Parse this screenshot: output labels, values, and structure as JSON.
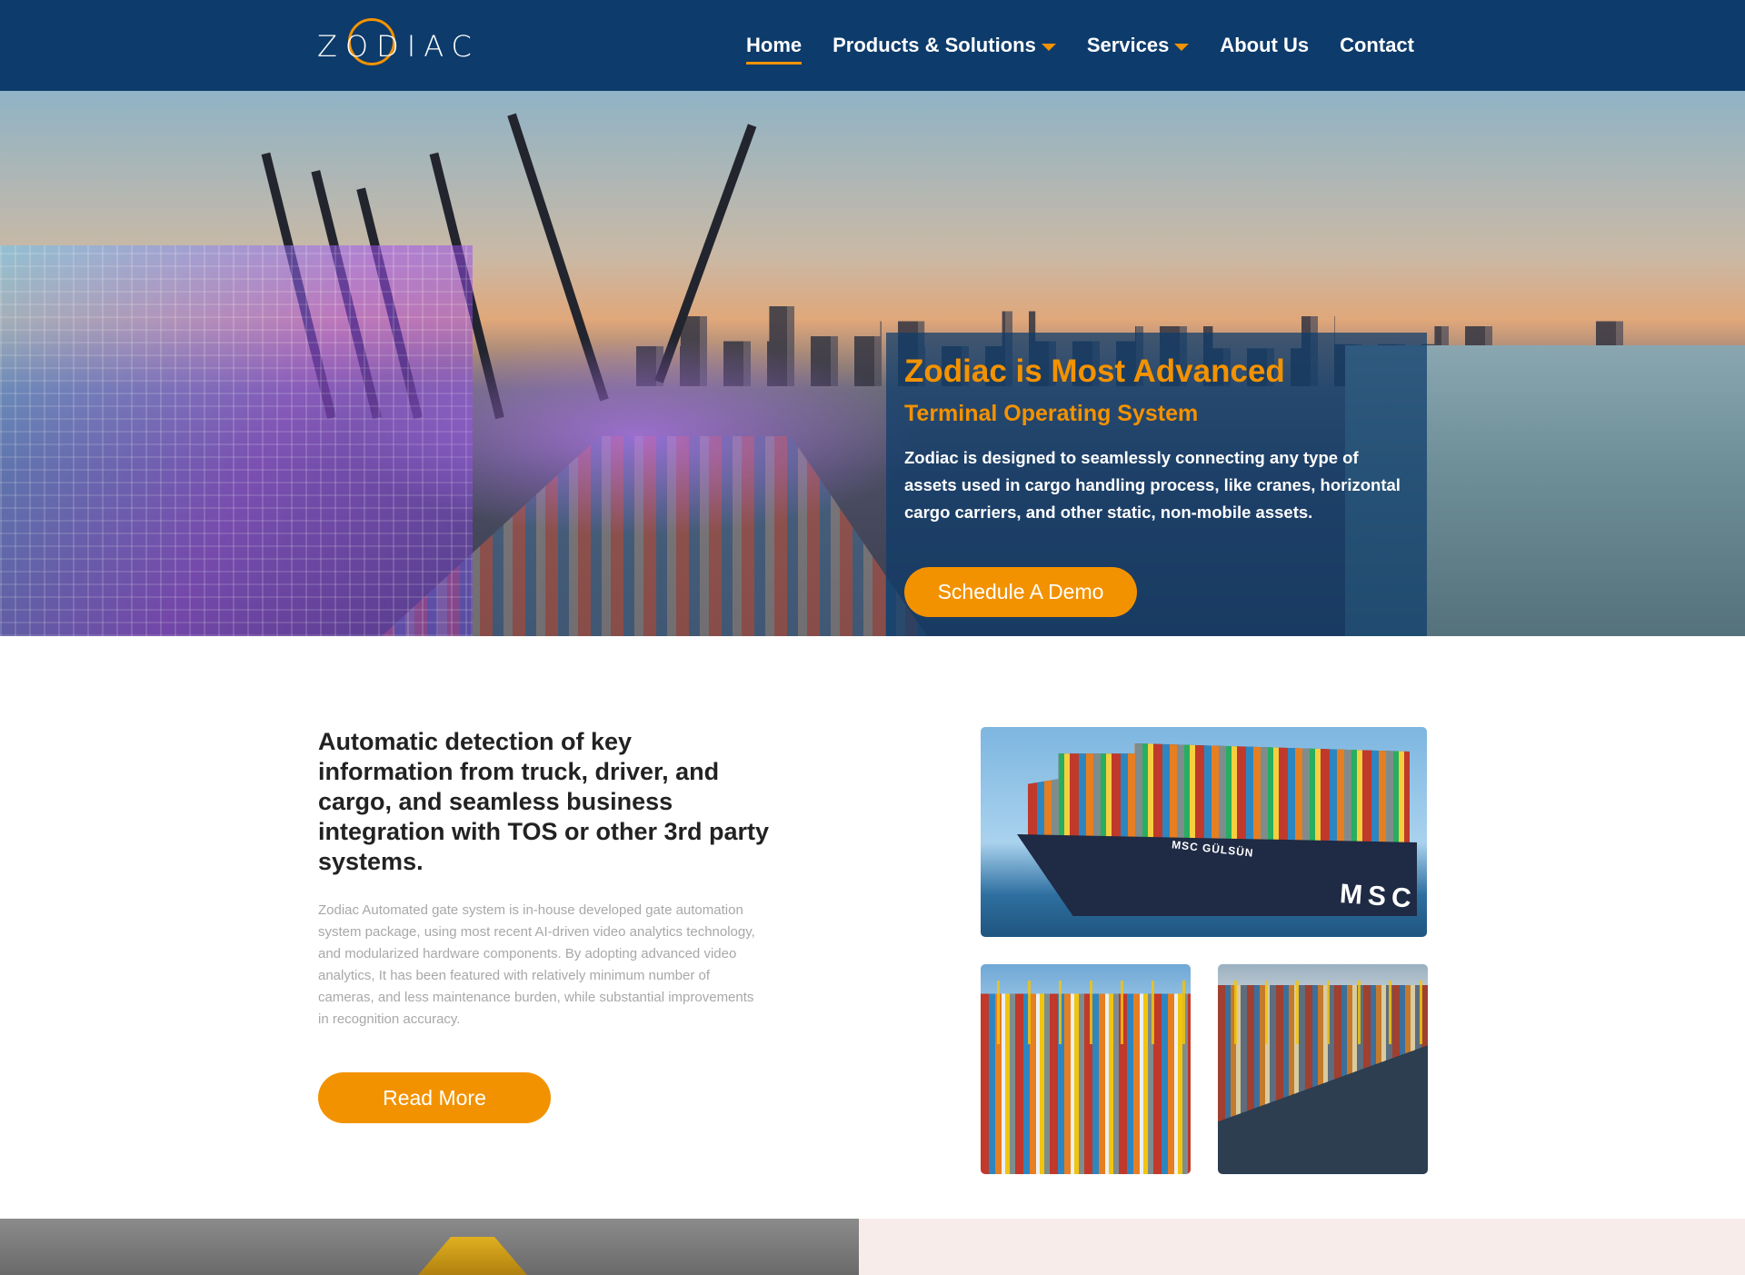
{
  "brand": {
    "logo_text": "ZODIAC"
  },
  "nav": {
    "items": [
      {
        "label": "Home",
        "active": true,
        "has_dropdown": false
      },
      {
        "label": "Products & Solutions",
        "active": false,
        "has_dropdown": true
      },
      {
        "label": "Services",
        "active": false,
        "has_dropdown": true
      },
      {
        "label": "About Us",
        "active": false,
        "has_dropdown": false
      },
      {
        "label": "Contact",
        "active": false,
        "has_dropdown": false
      }
    ]
  },
  "hero": {
    "title": "Zodiac is Most Advanced",
    "subtitle": "Terminal Operating System",
    "description": "Zodiac is designed to seamlessly connecting any type of assets used in cargo handling process, like cranes, horizontal cargo carriers, and other static, non-mobile assets.",
    "cta_label": "Schedule A Demo"
  },
  "feature": {
    "heading": "Automatic detection of key information from truck, driver, and cargo, and seamless business integration with TOS or other 3rd party systems.",
    "body": "Zodiac Automated gate system is in-house developed gate automation system package, using most recent AI-driven video analytics technology, and modularized hardware components. By adopting advanced video analytics, It has been featured with relatively minimum number of cameras, and less maintenance burden, while substantial improvements in recognition accuracy.",
    "button_label": "Read More",
    "ship_name": "MSC GÜLSÜN",
    "ship_logo": "MSC"
  },
  "colors": {
    "header_bg": "#0d3b6b",
    "accent": "#f39200",
    "heading_text": "#222222",
    "body_text": "#a8a8a8"
  }
}
